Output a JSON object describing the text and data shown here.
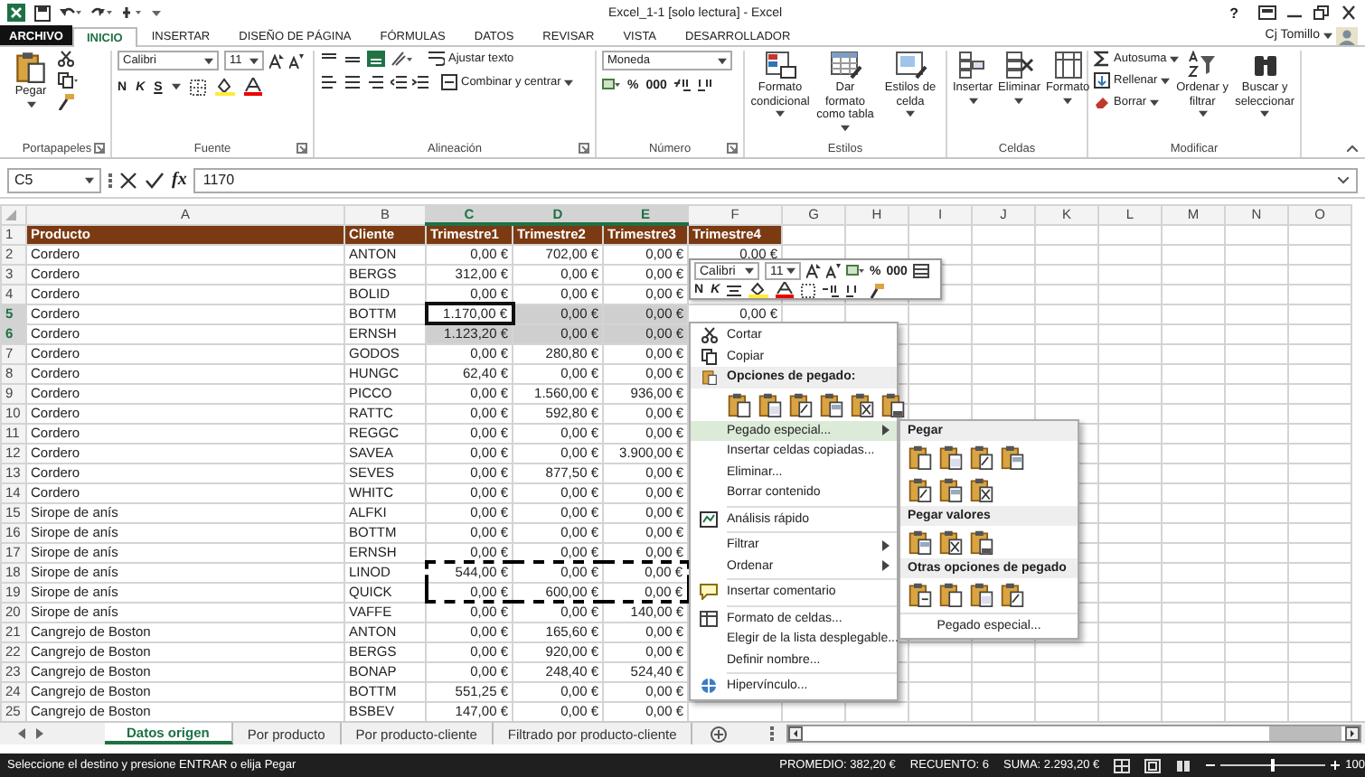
{
  "title_bar": {
    "title": "Excel_1-1 [solo lectura] - Excel",
    "help": "?"
  },
  "ribbon_tabs": [
    {
      "label": "ARCHIVO",
      "kind": "file",
      "selected": false
    },
    {
      "label": "INICIO",
      "kind": "tab",
      "selected": true
    },
    {
      "label": "INSERTAR",
      "kind": "tab",
      "selected": false
    },
    {
      "label": "DISEÑO DE PÁGINA",
      "kind": "tab",
      "selected": false
    },
    {
      "label": "FÓRMULAS",
      "kind": "tab",
      "selected": false
    },
    {
      "label": "DATOS",
      "kind": "tab",
      "selected": false
    },
    {
      "label": "REVISAR",
      "kind": "tab",
      "selected": false
    },
    {
      "label": "VISTA",
      "kind": "tab",
      "selected": false
    },
    {
      "label": "DESARROLLADOR",
      "kind": "tab",
      "selected": false
    }
  ],
  "user": "Cj Tomillo",
  "ribbon_groups": [
    {
      "kind": "clipboard",
      "label": "Portapapeles",
      "paste": "Pegar"
    },
    {
      "kind": "font",
      "label": "Fuente",
      "font": "Calibri",
      "size": "11",
      "bold": "N",
      "italic": "K",
      "underline": "S"
    },
    {
      "kind": "alignment",
      "label": "Alineación",
      "wrap": "Ajustar texto",
      "merge": "Combinar y centrar"
    },
    {
      "kind": "number",
      "label": "Número",
      "format": "Moneda",
      "percent": "%",
      "thousands": "000"
    },
    {
      "kind": "styles",
      "label": "Estilos",
      "buttons": [
        "Formato condicional",
        "Dar formato como tabla",
        "Estilos de celda"
      ]
    },
    {
      "kind": "cells",
      "label": "Celdas",
      "buttons": [
        "Insertar",
        "Eliminar",
        "Formato"
      ]
    },
    {
      "kind": "editing",
      "label": "Modificar",
      "small": [
        "Autosuma",
        "Rellenar",
        "Borrar"
      ],
      "buttons": [
        "Ordenar y filtrar",
        "Buscar y seleccionar"
      ]
    }
  ],
  "formula_bar": {
    "name_box": "C5",
    "fx": "fx",
    "value": "1170"
  },
  "columns": [
    {
      "label": "A",
      "selected": false
    },
    {
      "label": "B",
      "selected": false
    },
    {
      "label": "C",
      "selected": true
    },
    {
      "label": "D",
      "selected": true
    },
    {
      "label": "E",
      "selected": true
    },
    {
      "label": "F",
      "selected": false
    },
    {
      "label": "G",
      "selected": false
    },
    {
      "label": "H",
      "selected": false
    },
    {
      "label": "I",
      "selected": false
    },
    {
      "label": "J",
      "selected": false
    },
    {
      "label": "K",
      "selected": false
    },
    {
      "label": "L",
      "selected": false
    },
    {
      "label": "M",
      "selected": false
    },
    {
      "label": "N",
      "selected": false
    },
    {
      "label": "O",
      "selected": false
    }
  ],
  "rows": [
    {
      "kind": "header",
      "n": "1",
      "cells": [
        "Producto",
        "Cliente",
        "Trimestre1",
        "Trimestre2",
        "Trimestre3",
        "Trimestre4"
      ],
      "selected": false,
      "active": false,
      "copied": false
    },
    {
      "kind": "data",
      "n": "2",
      "cells": [
        "Cordero",
        "ANTON",
        "0,00 €",
        "702,00 €",
        "0,00 €",
        "0,00 €"
      ],
      "selected": false,
      "active": false,
      "copied": false
    },
    {
      "kind": "data",
      "n": "3",
      "cells": [
        "Cordero",
        "BERGS",
        "312,00 €",
        "0,00 €",
        "0,00 €"
      ],
      "selected": false,
      "active": false,
      "copied": false
    },
    {
      "kind": "data",
      "n": "4",
      "cells": [
        "Cordero",
        "BOLID",
        "0,00 €",
        "0,00 €",
        "0,00 €"
      ],
      "selected": false,
      "active": false,
      "copied": false
    },
    {
      "kind": "data",
      "n": "5",
      "cells": [
        "Cordero",
        "BOTTM",
        "1.170,00 €",
        "0,00 €",
        "0,00 €",
        "0,00 €"
      ],
      "selected": true,
      "active": true,
      "copied": false
    },
    {
      "kind": "data",
      "n": "6",
      "cells": [
        "Cordero",
        "ERNSH",
        "1.123,20 €",
        "0,00 €",
        "0,00 €"
      ],
      "selected": true,
      "active": false,
      "copied": false
    },
    {
      "kind": "data",
      "n": "7",
      "cells": [
        "Cordero",
        "GODOS",
        "0,00 €",
        "280,80 €",
        "0,00 €"
      ],
      "selected": false,
      "active": false,
      "copied": false
    },
    {
      "kind": "data",
      "n": "8",
      "cells": [
        "Cordero",
        "HUNGC",
        "62,40 €",
        "0,00 €",
        "0,00 €"
      ],
      "selected": false,
      "active": false,
      "copied": false
    },
    {
      "kind": "data",
      "n": "9",
      "cells": [
        "Cordero",
        "PICCO",
        "0,00 €",
        "1.560,00 €",
        "936,00 €"
      ],
      "selected": false,
      "active": false,
      "copied": false
    },
    {
      "kind": "data",
      "n": "10",
      "cells": [
        "Cordero",
        "RATTC",
        "0,00 €",
        "592,80 €",
        "0,00 €"
      ],
      "selected": false,
      "active": false,
      "copied": false
    },
    {
      "kind": "data",
      "n": "11",
      "cells": [
        "Cordero",
        "REGGC",
        "0,00 €",
        "0,00 €",
        "0,00 €"
      ],
      "selected": false,
      "active": false,
      "copied": false
    },
    {
      "kind": "data",
      "n": "12",
      "cells": [
        "Cordero",
        "SAVEA",
        "0,00 €",
        "0,00 €",
        "3.900,00 €"
      ],
      "selected": false,
      "active": false,
      "copied": false
    },
    {
      "kind": "data",
      "n": "13",
      "cells": [
        "Cordero",
        "SEVES",
        "0,00 €",
        "877,50 €",
        "0,00 €"
      ],
      "selected": false,
      "active": false,
      "copied": false
    },
    {
      "kind": "data",
      "n": "14",
      "cells": [
        "Cordero",
        "WHITC",
        "0,00 €",
        "0,00 €",
        "0,00 €"
      ],
      "selected": false,
      "active": false,
      "copied": false
    },
    {
      "kind": "data",
      "n": "15",
      "cells": [
        "Sirope de anís",
        "ALFKI",
        "0,00 €",
        "0,00 €",
        "0,00 €"
      ],
      "selected": false,
      "active": false,
      "copied": false
    },
    {
      "kind": "data",
      "n": "16",
      "cells": [
        "Sirope de anís",
        "BOTTM",
        "0,00 €",
        "0,00 €",
        "0,00 €"
      ],
      "selected": false,
      "active": false,
      "copied": false
    },
    {
      "kind": "data",
      "n": "17",
      "cells": [
        "Sirope de anís",
        "ERNSH",
        "0,00 €",
        "0,00 €",
        "0,00 €"
      ],
      "selected": false,
      "active": false,
      "copied": false
    },
    {
      "kind": "data",
      "n": "18",
      "cells": [
        "Sirope de anís",
        "LINOD",
        "544,00 €",
        "0,00 €",
        "0,00 €"
      ],
      "selected": false,
      "active": false,
      "copied": true
    },
    {
      "kind": "data",
      "n": "19",
      "cells": [
        "Sirope de anís",
        "QUICK",
        "0,00 €",
        "600,00 €",
        "0,00 €"
      ],
      "selected": false,
      "active": false,
      "copied": true
    },
    {
      "kind": "data",
      "n": "20",
      "cells": [
        "Sirope de anís",
        "VAFFE",
        "0,00 €",
        "0,00 €",
        "140,00 €"
      ],
      "selected": false,
      "active": false,
      "copied": false
    },
    {
      "kind": "data",
      "n": "21",
      "cells": [
        "Cangrejo de Boston",
        "ANTON",
        "0,00 €",
        "165,60 €",
        "0,00 €"
      ],
      "selected": false,
      "active": false,
      "copied": false
    },
    {
      "kind": "data",
      "n": "22",
      "cells": [
        "Cangrejo de Boston",
        "BERGS",
        "0,00 €",
        "920,00 €",
        "0,00 €"
      ],
      "selected": false,
      "active": false,
      "copied": false
    },
    {
      "kind": "data",
      "n": "23",
      "cells": [
        "Cangrejo de Boston",
        "BONAP",
        "0,00 €",
        "248,40 €",
        "524,40 €"
      ],
      "selected": false,
      "active": false,
      "copied": false
    },
    {
      "kind": "data",
      "n": "24",
      "cells": [
        "Cangrejo de Boston",
        "BOTTM",
        "551,25 €",
        "0,00 €",
        "0,00 €"
      ],
      "selected": false,
      "active": false,
      "copied": false
    },
    {
      "kind": "data",
      "n": "25",
      "cells": [
        "Cangrejo de Boston",
        "BSBEV",
        "147,00 €",
        "0,00 €",
        "0,00 €"
      ],
      "selected": false,
      "active": false,
      "copied": false
    }
  ],
  "mini_toolbar": {
    "font": "Calibri",
    "size": "11",
    "bold": "N",
    "italic": "K",
    "percent": "%",
    "thousands": "000"
  },
  "context_menu": {
    "items": [
      {
        "kind": "item",
        "label": "Cortar",
        "highlighted": false
      },
      {
        "kind": "item",
        "label": "Copiar",
        "highlighted": false
      },
      {
        "kind": "header",
        "label": "Opciones de pegado:"
      },
      {
        "kind": "paste_icons"
      },
      {
        "kind": "submenu",
        "label": "Pegado especial...",
        "highlighted": true
      },
      {
        "kind": "item",
        "label": "Insertar celdas copiadas...",
        "highlighted": false
      },
      {
        "kind": "item",
        "label": "Eliminar...",
        "highlighted": false
      },
      {
        "kind": "item",
        "label": "Borrar contenido",
        "highlighted": false
      },
      {
        "kind": "separator"
      },
      {
        "kind": "item",
        "label": "Análisis rápido",
        "highlighted": false
      },
      {
        "kind": "separator"
      },
      {
        "kind": "submenu",
        "label": "Filtrar",
        "highlighted": false
      },
      {
        "kind": "submenu",
        "label": "Ordenar",
        "highlighted": false
      },
      {
        "kind": "separator"
      },
      {
        "kind": "item",
        "label": "Insertar comentario",
        "highlighted": false
      },
      {
        "kind": "separator"
      },
      {
        "kind": "item",
        "label": "Formato de celdas...",
        "highlighted": false
      },
      {
        "kind": "item",
        "label": "Elegir de la lista desplegable...",
        "highlighted": false
      },
      {
        "kind": "item",
        "label": "Definir nombre...",
        "highlighted": false
      },
      {
        "kind": "separator"
      },
      {
        "kind": "item",
        "label": "Hipervínculo...",
        "highlighted": false
      }
    ]
  },
  "paste_submenu": {
    "sections": [
      {
        "title": "Pegar"
      },
      {
        "title": "Pegar valores"
      },
      {
        "title": "Otras opciones de pegado"
      }
    ],
    "footer": "Pegado especial..."
  },
  "sheet_tabs": [
    {
      "label": "Datos origen",
      "selected": true
    },
    {
      "label": "Por producto",
      "selected": false
    },
    {
      "label": "Por producto-cliente",
      "selected": false
    },
    {
      "label": "Filtrado por producto-cliente",
      "selected": false
    }
  ],
  "status_bar": {
    "message": "Seleccione el destino y presione ENTRAR o elija Pegar",
    "average": "PROMEDIO: 382,20 €",
    "count": "RECUENTO: 6",
    "sum": "SUMA: 2.293,20 €",
    "zoom_slider": {
      "level": 0.5
    },
    "zoom": "100"
  }
}
